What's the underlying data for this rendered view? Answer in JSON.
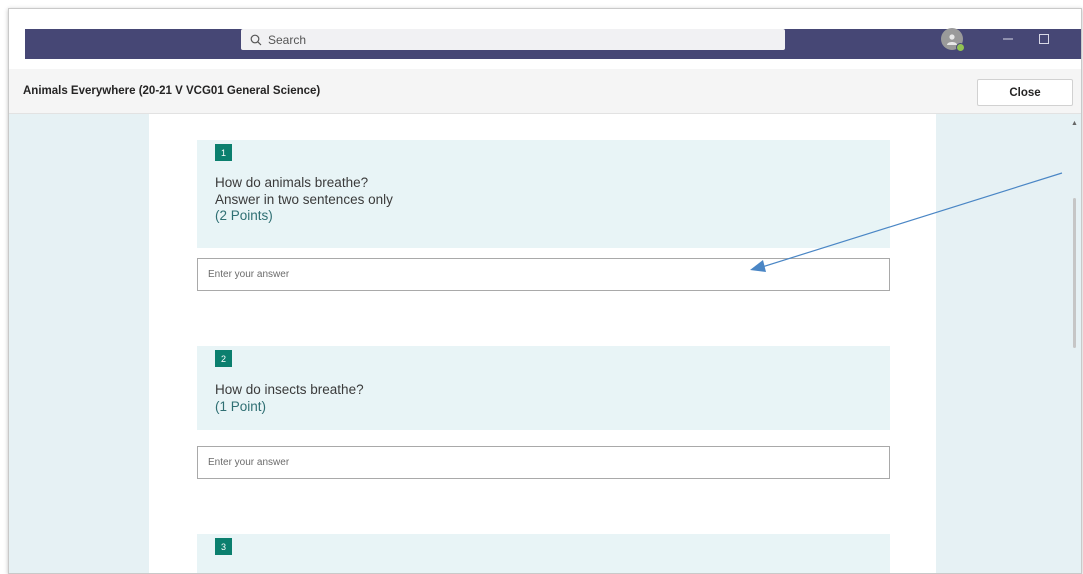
{
  "search": {
    "placeholder": "Search"
  },
  "header": {
    "title": "Animals Everywhere (20-21 V VCG01 General Science)",
    "close_label": "Close"
  },
  "questions": [
    {
      "number": "1",
      "line1": "How do animals breathe?",
      "line2": "Answer in two sentences only",
      "points": "(2 Points)",
      "answer_placeholder": "Enter your answer"
    },
    {
      "number": "2",
      "line1": "How do insects breathe?",
      "points": "(1 Point)",
      "answer_placeholder": "Enter your answer"
    },
    {
      "number": "3"
    }
  ],
  "colors": {
    "topbar": "#464775",
    "accent_teal": "#0b7f6e",
    "question_bg": "#e8f4f6",
    "page_bg": "#e6f1f4",
    "annotation_arrow": "#4a86c5"
  },
  "icons": {
    "search": "search-icon",
    "avatar": "avatar-icon",
    "minimize": "minimize-icon",
    "maximize": "maximize-icon"
  }
}
